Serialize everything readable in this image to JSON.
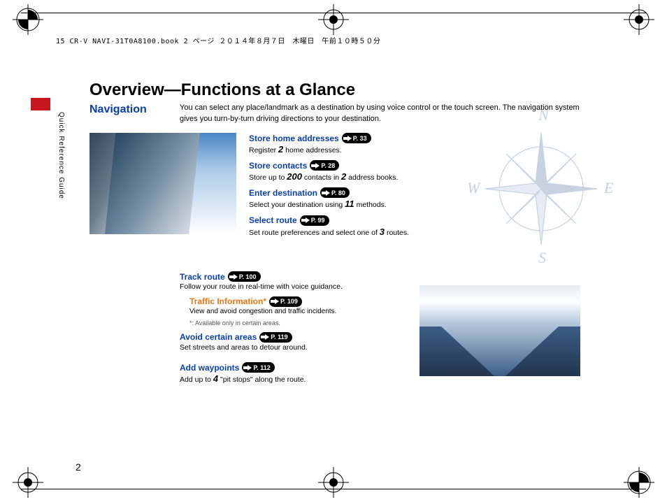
{
  "header_line": "15 CR-V NAVI-31T0A8100.book  2 ページ  ２０１４年８月７日　木曜日　午前１０時５０分",
  "side_label": "Quick Reference Guide",
  "title": "Overview—Functions at a Glance",
  "subtitle": "Navigation",
  "intro": "You can select any place/landmark as a destination by using voice control or the touch screen. The navigation system gives you turn-by-turn driving directions to your destination.",
  "items_right": [
    {
      "title": "Store home addresses",
      "page": "P. 33",
      "body_pre": "Register ",
      "num": "2",
      "body_post": " home addresses."
    },
    {
      "title": "Store contacts",
      "page": "P. 28",
      "body_pre": "Store up to ",
      "num": "200",
      "body_post": " contacts in ",
      "num2": "2",
      "body_post2": " address books."
    },
    {
      "title": "Enter destination",
      "page": "P. 80",
      "body_pre": "Select your destination using ",
      "num": "11",
      "body_post": " methods."
    },
    {
      "title": "Select route",
      "page": "P. 99",
      "body_pre": "Set route preferences and select one of ",
      "num": "3",
      "body_post": " routes."
    }
  ],
  "track": {
    "title": "Track route",
    "page": "P. 100",
    "body": "Follow your route in real-time with voice guidance."
  },
  "traffic": {
    "title": "Traffic Information*",
    "page": "P. 109",
    "body": "View and avoid congestion and traffic incidents.",
    "note": "*: Available only in certain areas."
  },
  "avoid": {
    "title": "Avoid certain areas",
    "page": "P. 119",
    "body": "Set streets and areas to detour around."
  },
  "waypoints": {
    "title": "Add waypoints",
    "page": "P. 112",
    "body_pre": "Add up to ",
    "num": "4",
    "body_post": " \"pit stops\" along the route."
  },
  "compass": {
    "n": "N",
    "e": "E",
    "s": "S",
    "w": "W"
  },
  "page_number": "2"
}
